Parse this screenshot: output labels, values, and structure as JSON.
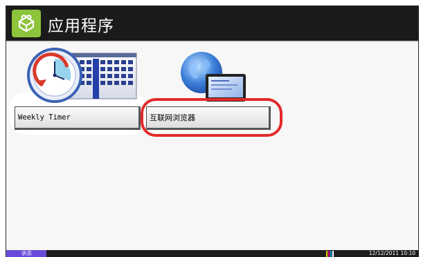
{
  "header": {
    "title": "应用程序",
    "icon": "application-icon",
    "icon_bg": "#8cc43c"
  },
  "apps": [
    {
      "label": "Weekly Timer",
      "icon": "weekly-timer-icon"
    },
    {
      "label": "互联网浏览器",
      "icon": "internet-browser-icon"
    }
  ],
  "status_bar": {
    "status_label": "状态",
    "datetime": "12/12/2011  10:10",
    "toner_colors": [
      "#ffd400",
      "#e0007a",
      "#00a0e0",
      "#222222"
    ]
  },
  "colors": {
    "highlight": "#e32a2a",
    "status_tab": "#6a4bd8"
  }
}
